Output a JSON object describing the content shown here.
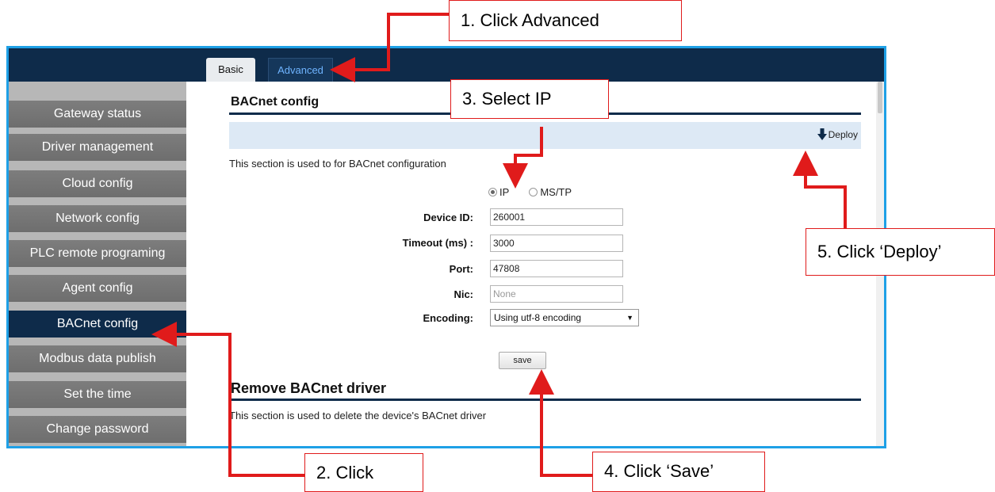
{
  "tabs": [
    {
      "label": "Basic"
    },
    {
      "label": "Advanced"
    }
  ],
  "sidebar": {
    "items": [
      {
        "label": "Gateway status"
      },
      {
        "label": "Driver management"
      },
      {
        "label": "Cloud config"
      },
      {
        "label": "Network config"
      },
      {
        "label": "PLC remote programing"
      },
      {
        "label": "Agent config"
      },
      {
        "label": "BACnet config"
      },
      {
        "label": "Modbus data publish"
      },
      {
        "label": "Set the time"
      },
      {
        "label": "Change password"
      }
    ]
  },
  "main": {
    "title": "BACnet config",
    "deploy_label": "Deploy",
    "description": "This section is used to for BACnet configuration",
    "protocol": {
      "selected": "IP",
      "options": [
        "IP",
        "MS/TP"
      ]
    },
    "fields": {
      "device_id": {
        "label": "Device ID:",
        "value": "260001"
      },
      "timeout": {
        "label": "Timeout (ms) :",
        "value": "3000"
      },
      "port": {
        "label": "Port:",
        "value": "47808"
      },
      "nic": {
        "label": "Nic:",
        "placeholder": "None"
      },
      "encoding": {
        "label": "Encoding:",
        "value": "Using utf-8 encoding"
      }
    },
    "save_label": "save",
    "remove": {
      "title": "Remove BACnet driver",
      "description": "This section is used to delete the device's BACnet driver"
    }
  },
  "callouts": {
    "step1": "1. Click Advanced",
    "step2": "2. Click",
    "step3": "3. Select IP",
    "step4": "4. Click ‘Save’",
    "step5": "5. Click ‘Deploy’"
  },
  "colors": {
    "navy": "#0e2b4a",
    "frame": "#1ea0e6",
    "annotation": "#e01b1b"
  }
}
